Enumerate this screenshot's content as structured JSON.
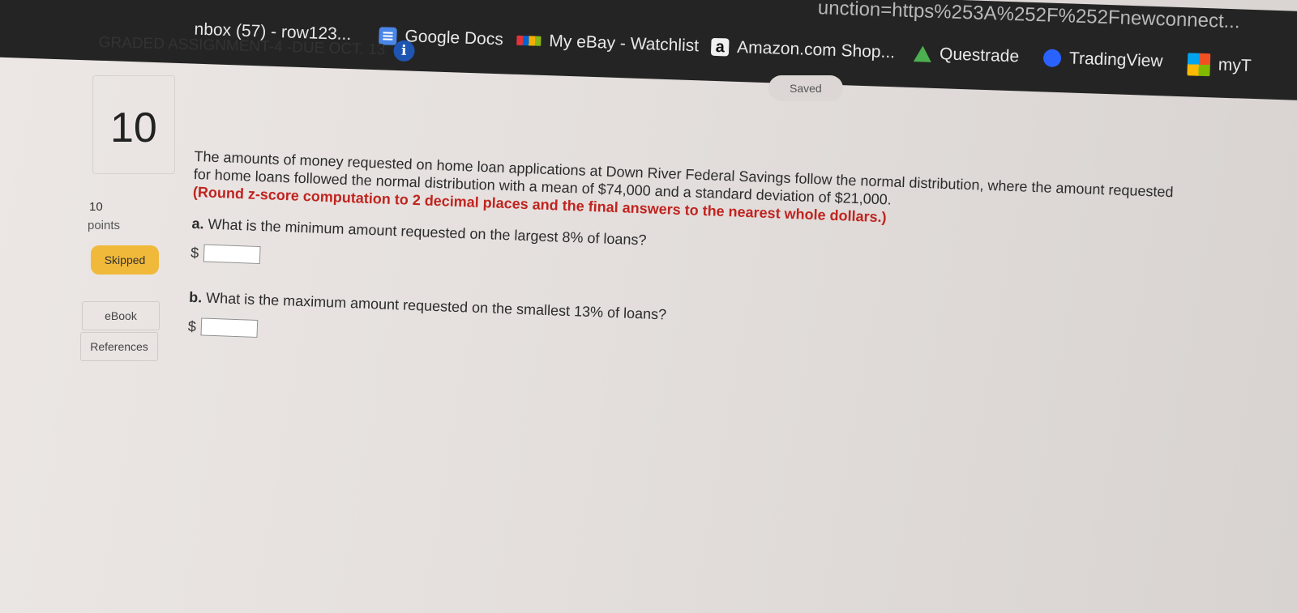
{
  "browser": {
    "url_fragment": "unction=https%253A%252F%252Fnewconnect...",
    "bookmarks": [
      {
        "label": "nbox (57) - row123...",
        "icon": "mail-icon"
      },
      {
        "label": "Google Docs",
        "icon": "google-docs-icon"
      },
      {
        "label": "My eBay - Watchlist",
        "icon": "ebay-icon"
      },
      {
        "label": "Amazon.com Shop...",
        "icon": "amazon-icon"
      },
      {
        "label": "Questrade",
        "icon": "questrade-icon"
      },
      {
        "label": "TradingView",
        "icon": "tradingview-icon"
      },
      {
        "label": "myT",
        "icon": "microsoft-icon"
      }
    ]
  },
  "assignment": {
    "title": "GRADED ASSIGNMENT-4 -DUE OCT. 13",
    "info_icon": "i",
    "status": "Saved"
  },
  "question": {
    "number": "10",
    "points_value": "10",
    "points_label": "points",
    "status_badge": "Skipped",
    "ebook_label": "eBook",
    "references_label": "References",
    "text": "The amounts of money requested on home loan applications at Down River Federal Savings follow the normal distribution, where the amount requested for home loans followed the normal distribution with a mean of $74,000 and a standard deviation of $21,000.",
    "note": "(Round z-score computation to 2 decimal places and the final answers to the nearest whole dollars.)",
    "parts": [
      {
        "letter": "a.",
        "text": "What is the minimum amount requested on the largest 8% of loans?",
        "currency": "$",
        "value": ""
      },
      {
        "letter": "b.",
        "text": "What is the maximum amount requested on the smallest 13% of loans?",
        "currency": "$",
        "value": ""
      }
    ]
  },
  "colors": {
    "note_red": "#c0241f",
    "skipped_badge": "#f0b93a",
    "info_blue": "#1e55b3",
    "browser_bar": "#242424"
  }
}
